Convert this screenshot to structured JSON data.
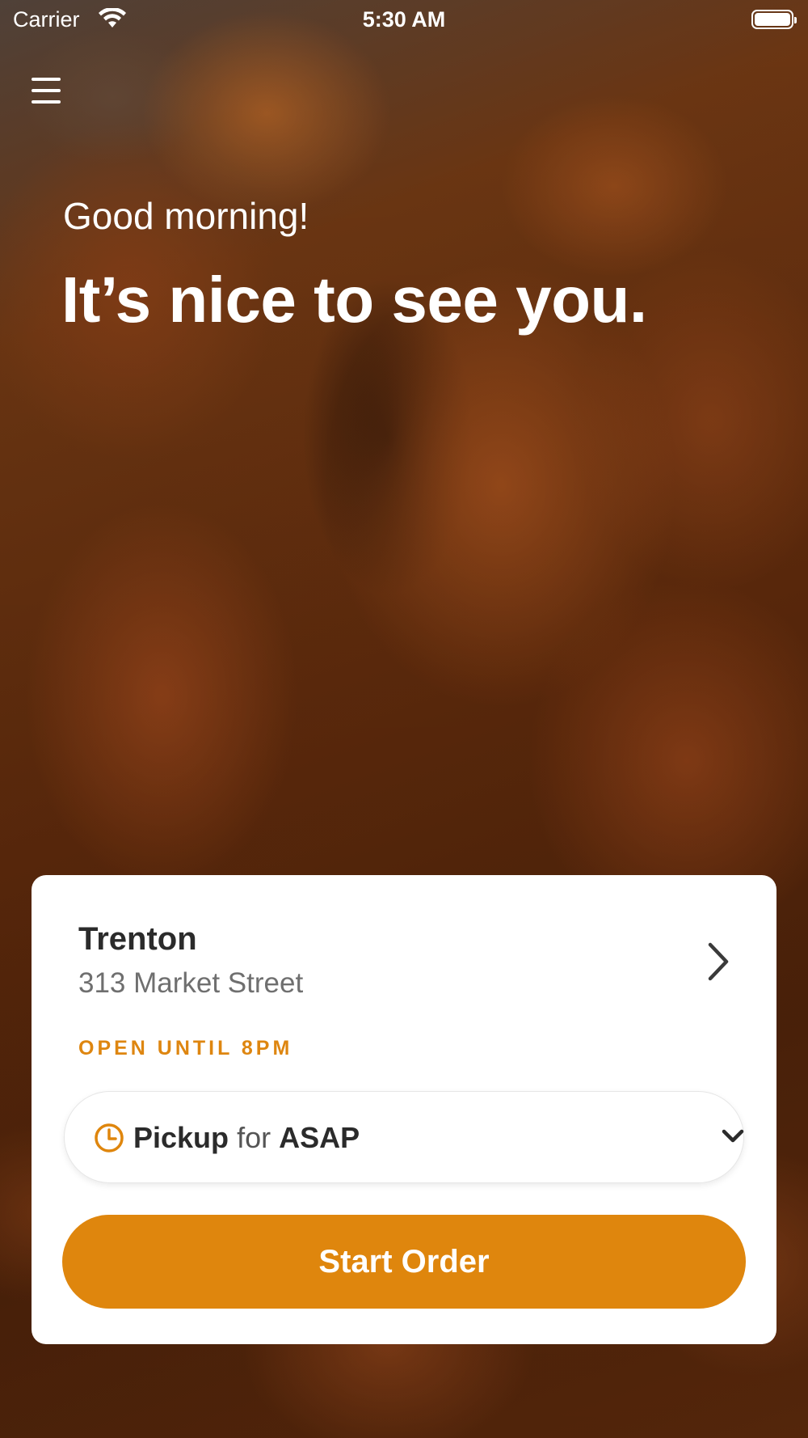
{
  "status_bar": {
    "carrier": "Carrier",
    "time": "5:30 AM",
    "icons": [
      "wifi-icon",
      "battery-icon"
    ]
  },
  "header": {
    "menu_icon": "hamburger-menu-icon"
  },
  "greeting": {
    "salutation": "Good morning!",
    "headline": "It’s nice to see you."
  },
  "location": {
    "name": "Trenton",
    "address": "313 Market Street",
    "status": "OPEN UNTIL 8PM",
    "chevron_icon": "chevron-right-icon"
  },
  "order_type": {
    "mode": "Pickup",
    "connector": "for",
    "time": "ASAP",
    "icon": "clock-icon",
    "dropdown_icon": "chevron-down-icon"
  },
  "actions": {
    "start_order_label": "Start Order"
  },
  "colors": {
    "accent": "#df860d",
    "card_background": "#ffffff",
    "text_primary": "#2b2b2b",
    "text_secondary": "#6f6f6f"
  }
}
